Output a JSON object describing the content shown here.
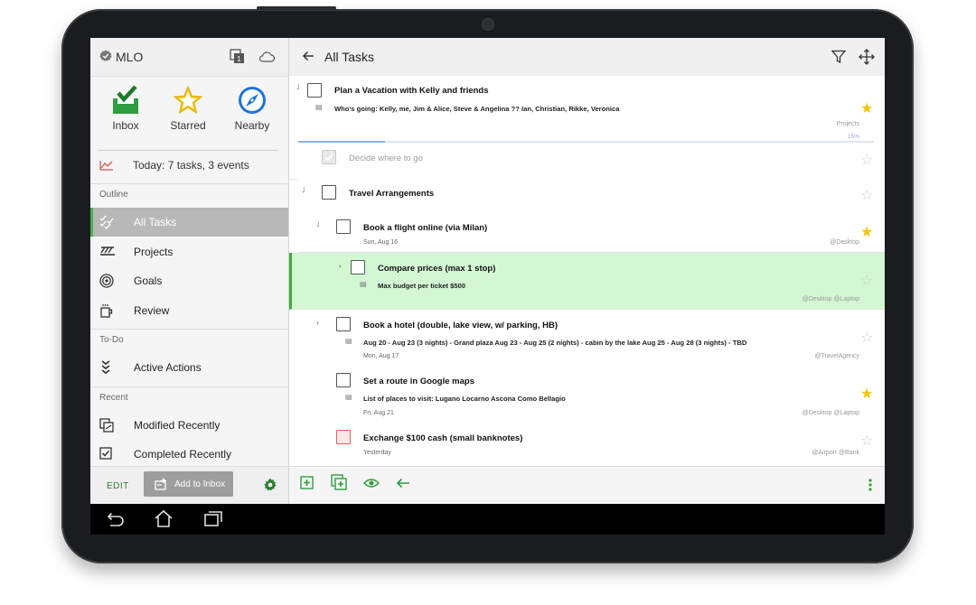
{
  "app": {
    "title": "MLO"
  },
  "quick": [
    {
      "label": "Inbox",
      "icon": "inbox-check-icon"
    },
    {
      "label": "Starred",
      "icon": "star-icon"
    },
    {
      "label": "Nearby",
      "icon": "compass-icon"
    }
  ],
  "today": {
    "label": "Today: 7 tasks, 3 events"
  },
  "sections": {
    "outline": "Outline",
    "todo": "To-Do",
    "recent": "Recent"
  },
  "nav": {
    "all_tasks": "All Tasks",
    "projects": "Projects",
    "goals": "Goals",
    "review": "Review",
    "active_actions": "Active Actions",
    "modified_recently": "Modified Recently",
    "completed_recently": "Completed Recently"
  },
  "sidebar_bottom": {
    "edit": "EDIT",
    "add_inbox": "Add to Inbox"
  },
  "header": {
    "title": "All Tasks"
  },
  "tasks": [
    {
      "title": "Plan a Vacation with Kelly and friends",
      "note": "Who's going: Kelly, me, Jim & Alice, Steve & Angelina ?? Ian, Christian, Rikke, Veronica",
      "context": "Projects",
      "progress_label": "15%",
      "progress": 0.15,
      "starred": true
    },
    {
      "title": "Decide where to go",
      "done": true,
      "starred": false
    },
    {
      "title": "Travel Arrangements",
      "starred": false
    },
    {
      "title": "Book a flight online (via Milan)",
      "date": "Sun, Aug 16",
      "context": "@Desktop",
      "starred": true
    },
    {
      "title": "Compare prices (max 1 stop)",
      "note": "Max budget per ticket $500",
      "context": "@Desktop  @Laptop",
      "starred": false,
      "highlighted": true
    },
    {
      "title": "Book a hotel (double, lake view, w/ parking, HB)",
      "note": "Aug 20 - Aug 23 (3 nights) - Grand plaza Aug 23 - Aug 25 (2 nights) - cabin by the lake Aug 25 - Aug 28 (3 nights) - TBD",
      "date": "Mon, Aug 17",
      "context": "@TravelAgency",
      "starred": false
    },
    {
      "title": "Set a route in Google maps",
      "note": "List of places to visit: Lugano Locarno Ascona Como Bellagio",
      "date": "Fri, Aug 21",
      "context": "@Desktop  @Laptop",
      "starred": true
    },
    {
      "title": "Exchange $100 cash (small banknotes)",
      "date": "Yesterday",
      "context": "@Airport  @Bank",
      "starred": false
    }
  ],
  "colors": {
    "accent": "#3daa43",
    "highlight": "#d3f7d3",
    "star": "#f7c600",
    "nearby_blue": "#1e74d4"
  }
}
